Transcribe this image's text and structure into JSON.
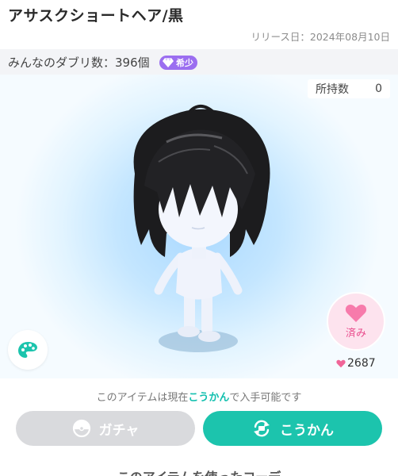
{
  "header": {
    "title": "アサスクショートヘア/黒",
    "release": "リリース日：2024年08月10日"
  },
  "duplicates": {
    "label": "みんなのダブリ数：396個",
    "rarity_badge": "希少"
  },
  "stage": {
    "owned_label": "所持数",
    "owned_count": "0",
    "like_label": "済み",
    "like_count": "2687",
    "palette_icon": "palette-icon",
    "like_icon": "heart-icon"
  },
  "availability": {
    "prefix": "このアイテムは現在",
    "highlight": "こうかん",
    "suffix": "で入手可能です"
  },
  "actions": {
    "gacha_label": "ガチャ",
    "exchange_label": "こうかん"
  },
  "footer": {
    "partial_heading": "このアイテムを使ったコーデ"
  },
  "colors": {
    "accent": "#1cc4ad",
    "like_pink": "#e94d8d",
    "rarity_purple": "#9b6ef0"
  }
}
